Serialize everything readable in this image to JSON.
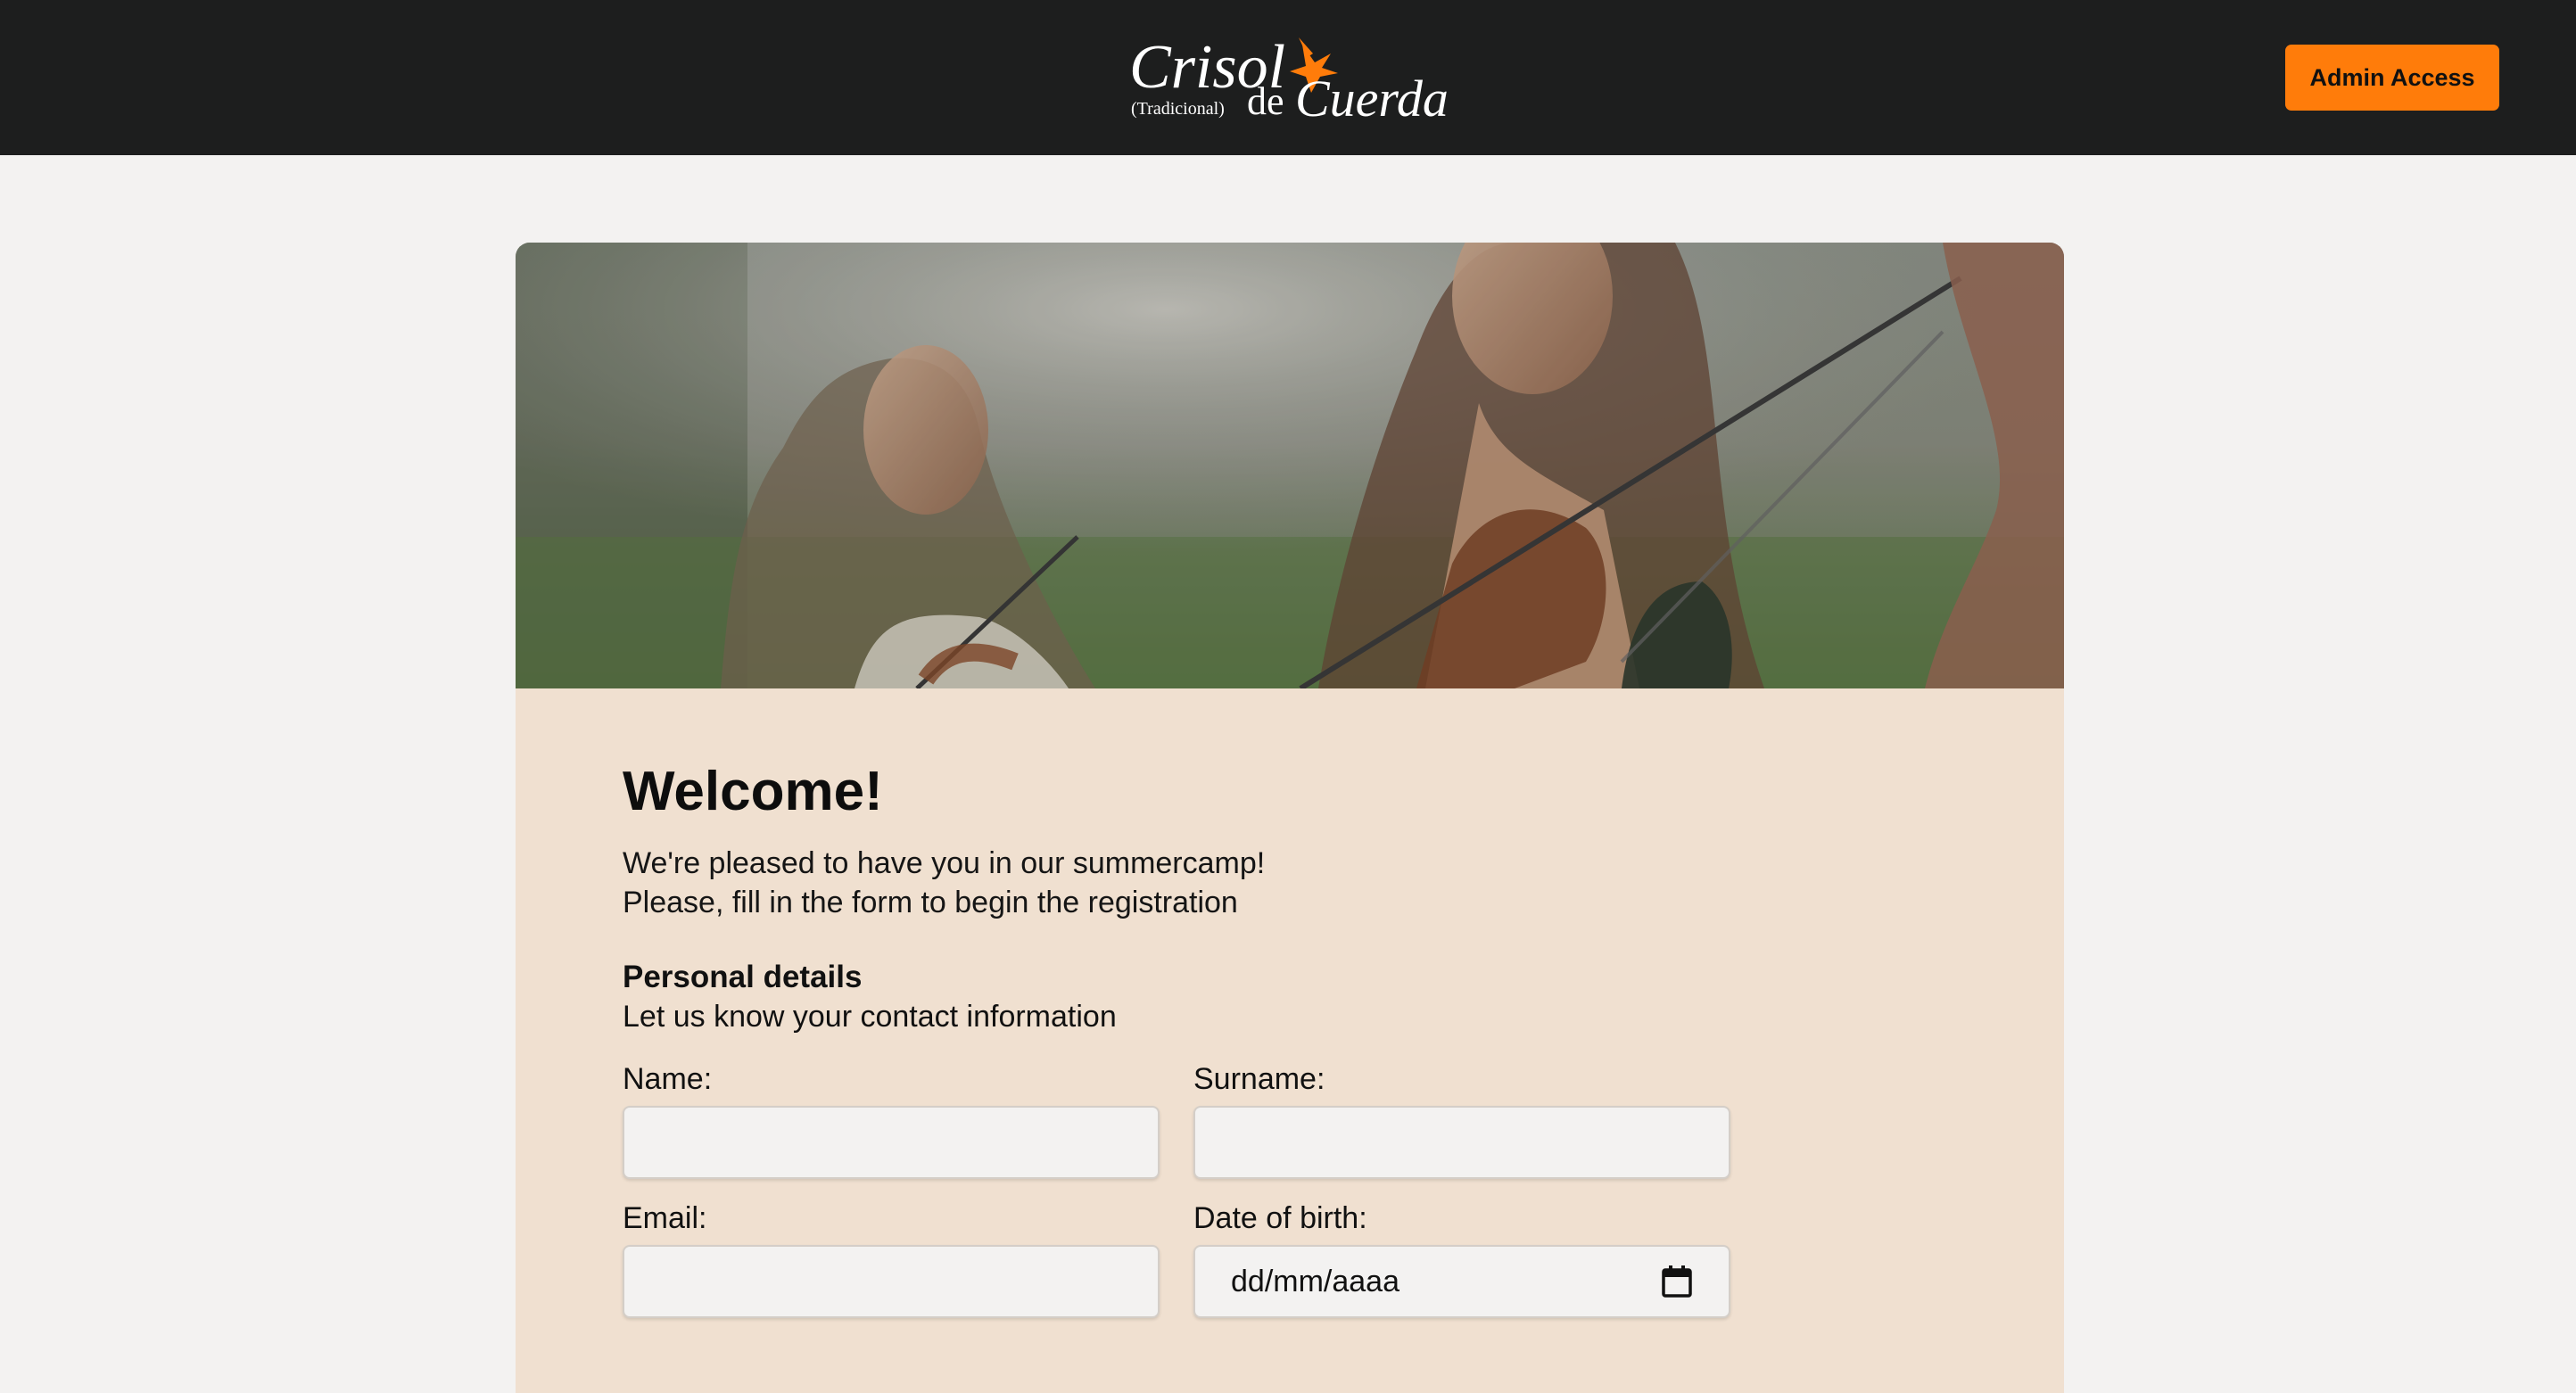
{
  "header": {
    "logo": {
      "word_1": "Crisol",
      "word_2": "de",
      "word_3": "Cuerda",
      "tagline": "(Tradicional)",
      "icon": "bird-icon"
    },
    "admin_button_label": "Admin Access"
  },
  "hero": {
    "image": "violinists-photo"
  },
  "welcome": {
    "title": "Welcome!",
    "line_1": "We're pleased to have you in our summercamp!",
    "line_2": "Please, fill in the form to begin the registration"
  },
  "personal": {
    "title": "Personal details",
    "subtitle": "Let us know your contact information"
  },
  "form": {
    "name_label": "Name:",
    "name_value": "",
    "surname_label": "Surname:",
    "surname_value": "",
    "email_label": "Email:",
    "email_value": "",
    "dob_label": "Date of birth:",
    "dob_placeholder": "dd/mm/aaaa",
    "dob_icon": "calendar-icon"
  },
  "colors": {
    "header_bg": "#1d1e1e",
    "accent": "#ff7c0a",
    "page_bg": "#f3f2f1",
    "card_bg": "#f0e0d0"
  }
}
